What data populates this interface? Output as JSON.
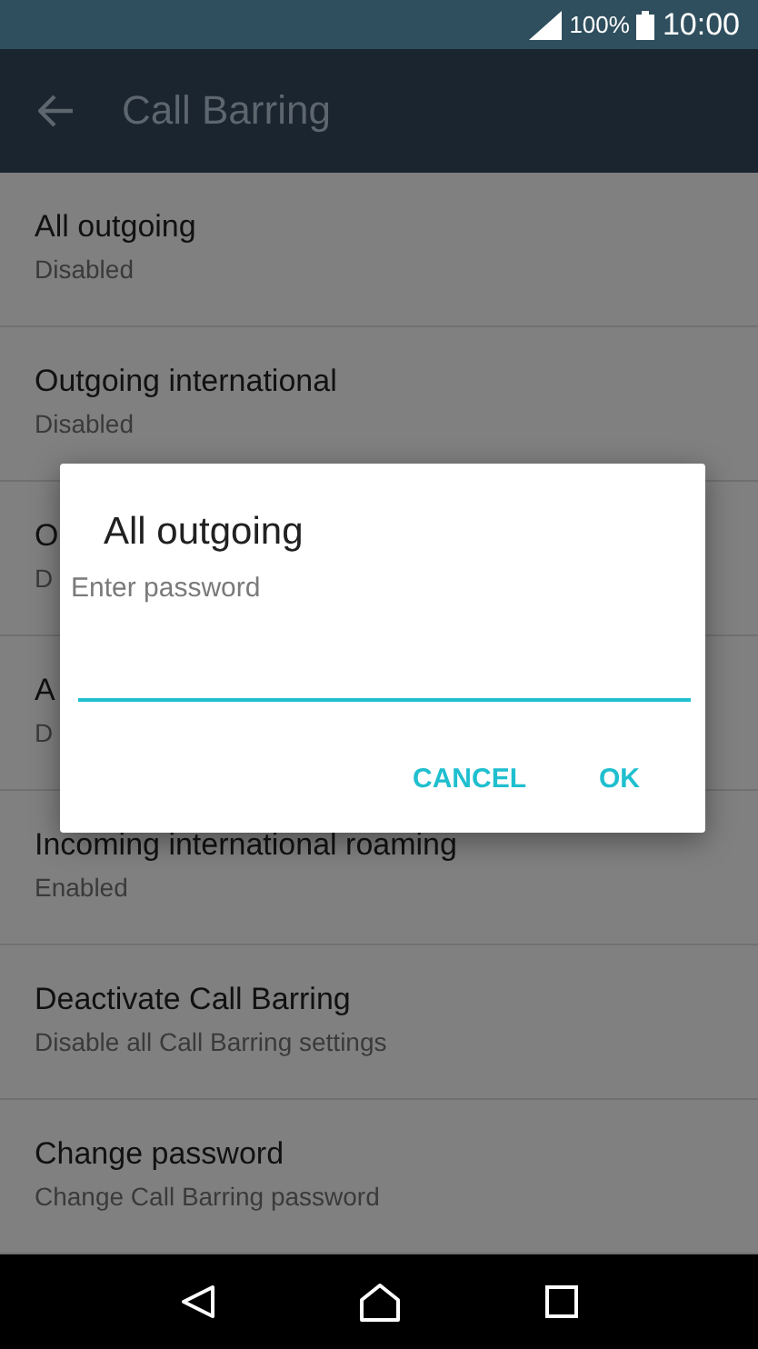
{
  "status_bar": {
    "battery": "100%",
    "time": "10:00"
  },
  "app_bar": {
    "title": "Call Barring"
  },
  "settings": [
    {
      "title": "All outgoing",
      "subtitle": "Disabled"
    },
    {
      "title": "Outgoing international",
      "subtitle": "Disabled"
    },
    {
      "title": "O",
      "subtitle": "D"
    },
    {
      "title": "A",
      "subtitle": "D"
    },
    {
      "title": "Incoming international roaming",
      "subtitle": "Enabled"
    },
    {
      "title": "Deactivate Call Barring",
      "subtitle": "Disable all Call Barring settings"
    },
    {
      "title": "Change password",
      "subtitle": "Change Call Barring password"
    }
  ],
  "dialog": {
    "title": "All outgoing",
    "field_label": "Enter password",
    "buttons": [
      "CANCEL",
      "OK"
    ]
  }
}
